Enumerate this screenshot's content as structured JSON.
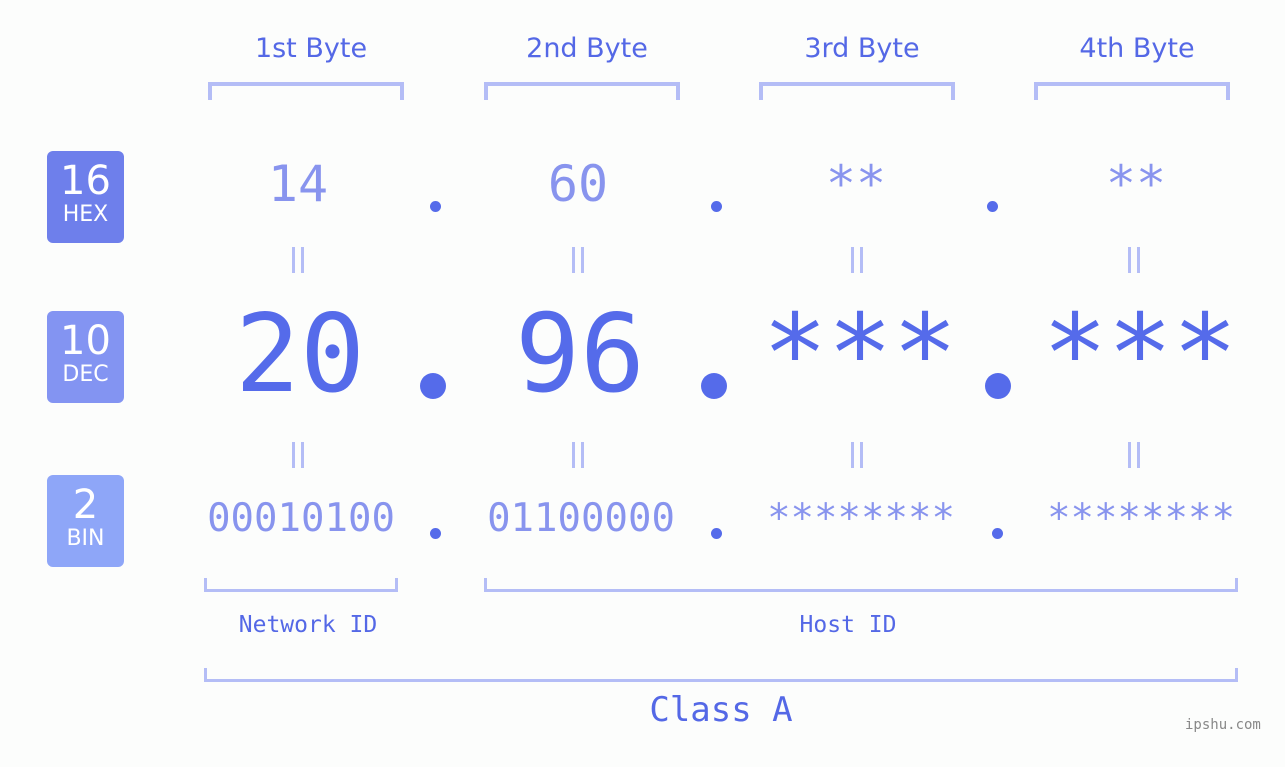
{
  "bytes": [
    {
      "label": "1st Byte",
      "hex": "14",
      "dec": "20",
      "bin": "00010100"
    },
    {
      "label": "2nd Byte",
      "hex": "60",
      "dec": "96",
      "bin": "01100000"
    },
    {
      "label": "3rd Byte",
      "hex": "**",
      "dec": "***",
      "bin": "********"
    },
    {
      "label": "4th Byte",
      "hex": "**",
      "dec": "***",
      "bin": "********"
    }
  ],
  "badges": {
    "hex": {
      "num": "16",
      "label": "HEX",
      "color": "#6e7feb"
    },
    "dec": {
      "num": "10",
      "label": "DEC",
      "color": "#8394f2"
    },
    "bin": {
      "num": "2",
      "label": "BIN",
      "color": "#8ea6f8"
    }
  },
  "segments": {
    "network": "Network ID",
    "host": "Host ID"
  },
  "class_label": "Class A",
  "brand": "ipshu.com",
  "colors": {
    "accent": "#556bea",
    "light": "#8894ee",
    "bracket": "#b4bdf6",
    "background": "#fcfdfc"
  }
}
